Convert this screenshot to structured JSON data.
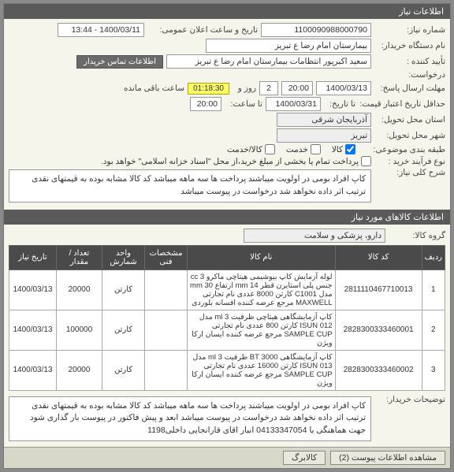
{
  "header": {
    "title": "اطلاعات نیاز"
  },
  "form": {
    "need_no_lbl": "شماره نیاز:",
    "need_no": "1100090988000790",
    "anc_lbl": "تاریخ و ساعت اعلان عمومی:",
    "anc_val": "1400/03/11 - 13:44",
    "device_lbl": "نام دستگاه خریدار:",
    "device_val": "بیمارستان امام رضا  ع  تبریز",
    "conf_lbl": "تأیید کننده :",
    "conf_val": "سعید اکبرپور انتظامات بیمارستان امام رضا  ع  تبریز",
    "contact_btn": "اطلاعات تماس خریدار",
    "req_lbl": "درخواست:",
    "deadline_lbl": "مهلت ارسال پاسخ:",
    "deadline_date": "1400/03/13",
    "deadline_time": "20:00",
    "days_val": "2",
    "days_lbl": "روز و",
    "timer_val": "01:18:30",
    "remain_lbl": "ساعت باقی مانده",
    "valid_lbl": "حداقل تاریخ اعتبار قیمت:",
    "valid_date_lbl": "تا تاریخ:",
    "valid_date": "1400/03/31",
    "valid_time_lbl": "تا ساعت:",
    "valid_time": "20:00",
    "delivery_lbl": "استان محل تحویل:",
    "delivery_val": "آذربایجان شرقی",
    "city_lbl": "شهر محل تحویل:",
    "city_val": "تبریز",
    "class_lbl": "طبقه بندی موضوعی:",
    "class_goods": "کالا",
    "class_service": "خدمت",
    "class_both": "کالا/خدمت",
    "buy_type_lbl": "نوع فرآیند خرید :",
    "buy_type_note": "پرداخت تمام یا بخشی از مبلغ خرید،از محل \"اسناد خزانه اسلامی\" خواهد بود.",
    "main_desc_lbl": "شرح کلی نیاز:",
    "main_desc": "کاپ افراد بومی در اولویت میباشند پرداخت ها سه ماهه میباشد کد کالا مشابه بوده به قیمتهای نقدی ترتیب اثر داده نخواهد شد درخواست در پیوست میباشد",
    "items_hdr": "اطلاعات کالاهای مورد نیاز",
    "group_lbl": "گروه کالا:",
    "group_val": "دارو، پزشکی و سلامت",
    "buyer_notes_lbl": "توضیحات خریدار:",
    "buyer_notes": "کاپ افراد بومی در اولویت میباشند پرداخت ها سه ماهه میباشد کد کالا مشابه بوده به قیمتهای نقدی ترتیب اثر داده نخواهد شد درخواست در پیوست میباشد ابعد و پیش فاکتور در پیوست بار گذاری شود جهت هماهنگی با 04133347054 انبار اقای قارانجایی داخلی1198"
  },
  "cols": {
    "idx": "ردیف",
    "code": "کد کالا",
    "name": "نام کالا",
    "spec": "مشخصات فنی",
    "unit": "واحد شمارش",
    "qty": "تعداد / مقدار",
    "date": "تاریخ نیاز"
  },
  "rows": [
    {
      "idx": "1",
      "code": "2811110467710013",
      "name": "لوله آزمایش کاپ بیوشیمی هیتاچی ماکرو 3 cc جنس پلی استایرن قطر 14 mm ارتفاع 30 mm مدل C1001 کارتن 8000 عددی نام تجارتی MAXWELL مرجع عرضه کننده افسانه بلوردی",
      "unit": "کارتن",
      "qty": "20000",
      "date": "1400/03/13"
    },
    {
      "idx": "2",
      "code": "2828300333460001",
      "name": "کاپ آزمایشگاهی هیتاچی ظرفیت 3 ml مدل ISUN 012 کارتن 800 عددی نام تجارتی SAMPLE CUP مرجع عرضه کننده ایسان ارکا ویژن",
      "unit": "کارتن",
      "qty": "100000",
      "date": "1400/03/13"
    },
    {
      "idx": "3",
      "code": "2828300333460002",
      "name": "کاپ آزمایشگاهی BT 3000 ظرفیت 3 ml مدل ISUN 013 کارتن 16000 عددی نام تجارتی SAMPLE CUP مرجع عرضه کننده ایسان ارکا ویژن",
      "unit": "کارتن",
      "qty": "20000",
      "date": "1400/03/13"
    }
  ],
  "foot": {
    "view_attach": "مشاهده اطلاعات پیوست (2)",
    "kalibarg": "کالابرگ"
  }
}
